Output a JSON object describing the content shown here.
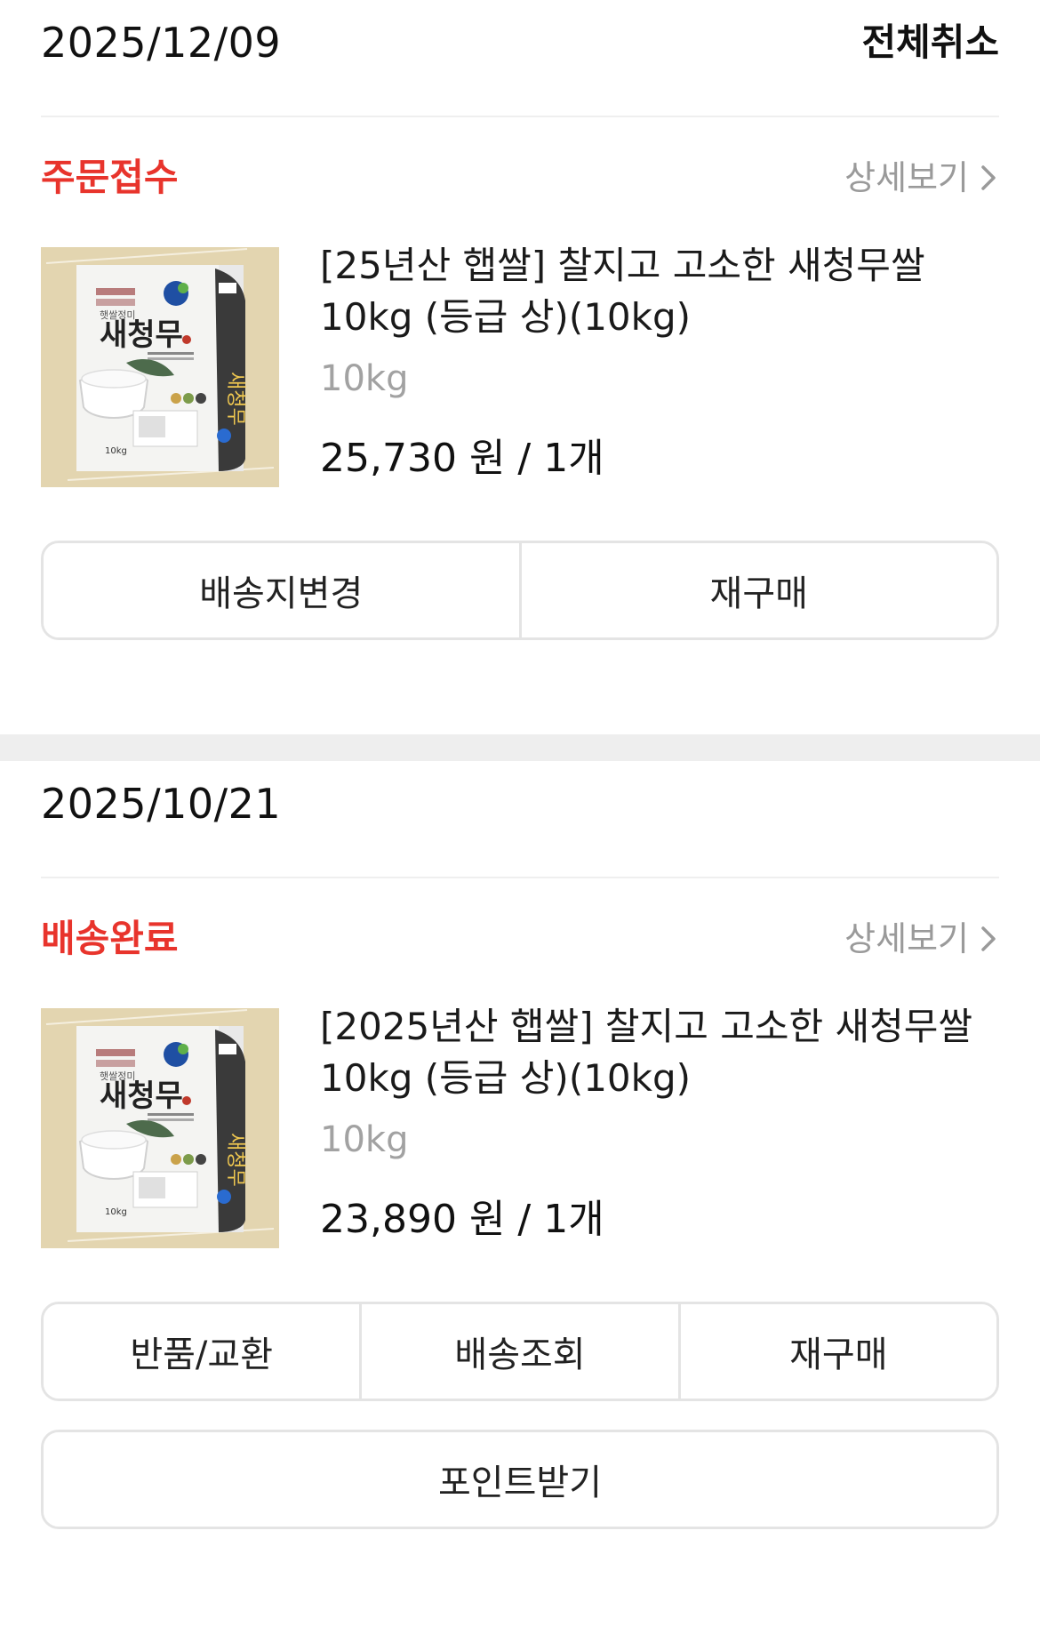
{
  "orders": [
    {
      "date": "2025/12/09",
      "cancel_all_label": "전체취소",
      "status": "주문접수",
      "detail_label": "상세보기",
      "product": {
        "name": "[25년산 햅쌀] 찰지고 고소한 새청무쌀 10kg (등급 상)(10kg)",
        "option": "10kg",
        "price": "25,730 원 / 1개",
        "image_label": "새청무"
      },
      "buttons": [
        "배송지변경",
        "재구매"
      ]
    },
    {
      "date": "2025/10/21",
      "status": "배송완료",
      "detail_label": "상세보기",
      "product": {
        "name": "[2025년산 햅쌀] 찰지고 고소한 새청무쌀 10kg (등급 상)(10kg)",
        "option": "10kg",
        "price": "23,890 원 / 1개",
        "image_label": "새청무"
      },
      "buttons": [
        "반품/교환",
        "배송조회",
        "재구매"
      ],
      "extra_button": "포인트받기"
    }
  ],
  "colors": {
    "status_red": "#e8342c",
    "muted_gray": "#9a9a9a",
    "border_gray": "#e4e4e4",
    "divider_gray": "#eeeeee"
  },
  "icons": {
    "detail_chevron": "chevron-right-icon"
  }
}
